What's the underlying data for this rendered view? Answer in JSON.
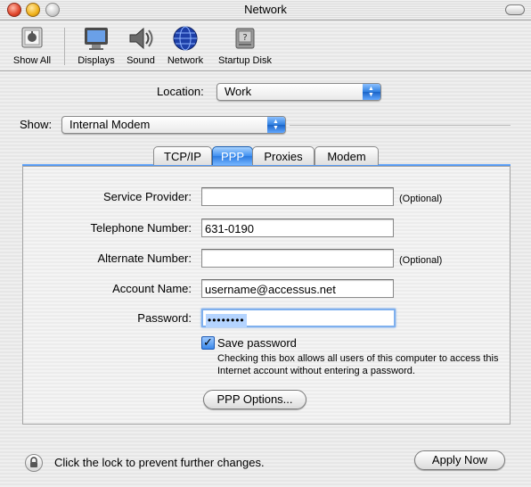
{
  "window": {
    "title": "Network"
  },
  "toolbar": {
    "items": [
      {
        "label": "Show All",
        "icon": "show-all-icon"
      },
      {
        "label": "Displays",
        "icon": "display-icon"
      },
      {
        "label": "Sound",
        "icon": "speaker-icon"
      },
      {
        "label": "Network",
        "icon": "globe-icon"
      },
      {
        "label": "Startup Disk",
        "icon": "disk-icon"
      }
    ]
  },
  "location": {
    "label": "Location:",
    "value": "Work"
  },
  "show": {
    "label": "Show:",
    "value": "Internal Modem"
  },
  "tabs": [
    {
      "label": "TCP/IP",
      "selected": false
    },
    {
      "label": "PPP",
      "selected": true
    },
    {
      "label": "Proxies",
      "selected": false
    },
    {
      "label": "Modem",
      "selected": false
    }
  ],
  "form": {
    "service_provider": {
      "label": "Service Provider:",
      "value": "",
      "note": "(Optional)"
    },
    "telephone": {
      "label": "Telephone Number:",
      "value": "631-0190"
    },
    "alternate": {
      "label": "Alternate Number:",
      "value": "",
      "note": "(Optional)"
    },
    "account": {
      "label": "Account Name:",
      "value": "username@accessus.net"
    },
    "password": {
      "label": "Password:",
      "value": "••••••••"
    },
    "save_password": {
      "label": "Save password",
      "checked": true,
      "help": "Checking this box allows all users of this computer to access this Internet account without entering a password."
    },
    "ppp_options": "PPP Options..."
  },
  "footer": {
    "lock_text": "Click the lock to prevent further changes.",
    "apply_label": "Apply Now"
  },
  "colors": {
    "accent": "#2f7fe0",
    "selection": "#b4d4ff"
  }
}
